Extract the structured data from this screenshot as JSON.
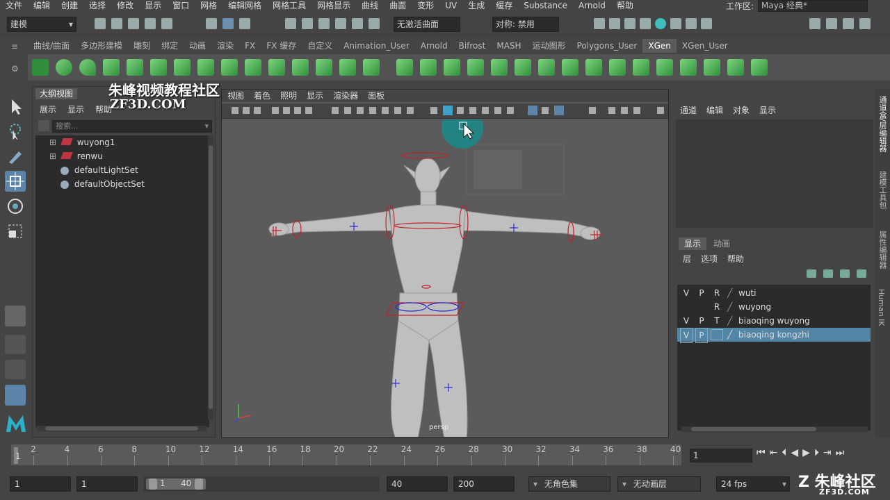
{
  "menubar": {
    "items": [
      "文件",
      "编辑",
      "创建",
      "选择",
      "修改",
      "显示",
      "窗口",
      "网格",
      "编辑网格",
      "网格工具",
      "网格显示",
      "曲线",
      "曲面",
      "变形",
      "UV",
      "生成",
      "缓存",
      "Substance",
      "Arnold",
      "帮助"
    ],
    "workspace_label": "工作区:",
    "workspace_value": "Maya 经典*"
  },
  "statusline": {
    "mode": "建模",
    "live_surface": "无激活曲面",
    "symmetry": "对称: 禁用"
  },
  "shelf": {
    "tabs": [
      "曲线/曲面",
      "多边形建模",
      "雕刻",
      "绑定",
      "动画",
      "渲染",
      "FX",
      "FX 缓存",
      "自定义",
      "Animation_User",
      "Arnold",
      "Bifrost",
      "MASH",
      "运动图形",
      "Polygons_User",
      "XGen",
      "XGen_User"
    ],
    "active": "XGen"
  },
  "outliner": {
    "title": "大纲视图",
    "menu": [
      "展示",
      "显示",
      "帮助"
    ],
    "search_placeholder": "搜索...",
    "items": [
      "wuyong1",
      "renwu",
      "defaultLightSet",
      "defaultObjectSet"
    ]
  },
  "viewport": {
    "menu": [
      "视图",
      "着色",
      "照明",
      "显示",
      "渲染器",
      "面板"
    ],
    "camera_label": "persp"
  },
  "channelbox": {
    "menu": [
      "通道",
      "编辑",
      "对象",
      "显示"
    ]
  },
  "layers": {
    "tabs": [
      "显示",
      "动画"
    ],
    "menu": [
      "层",
      "选项",
      "帮助"
    ],
    "rows": [
      {
        "v": "V",
        "p": "P",
        "r": "R",
        "name": "wuti",
        "selected": false
      },
      {
        "v": "",
        "p": "",
        "r": "R",
        "name": "wuyong",
        "selected": false
      },
      {
        "v": "V",
        "p": "P",
        "r": "T",
        "name": "biaoqing wuyong",
        "selected": false
      },
      {
        "v": "V",
        "p": "P",
        "r": "",
        "name": "biaoqing kongzhi",
        "selected": true
      }
    ]
  },
  "sidebar_tabs": [
    "通道盒/层编辑器",
    "建模工具包",
    "属性编辑器",
    "Human IK"
  ],
  "timeline": {
    "ticks": [
      "2",
      "4",
      "6",
      "8",
      "10",
      "12",
      "14",
      "16",
      "18",
      "20",
      "22",
      "24",
      "26",
      "28",
      "30",
      "32",
      "34",
      "36",
      "38",
      "40"
    ],
    "start_marker": "1",
    "current_frame": "1"
  },
  "range": {
    "start": "1",
    "playback_start": "1",
    "range_start_label": "1",
    "range_end_label": "40",
    "playback_end": "40",
    "end": "200",
    "character_set": "无角色集",
    "anim_layer": "无动画层",
    "fps": "24 fps"
  },
  "watermark": {
    "corner": "Z 朱峰社区",
    "corner_url": "ZF3D.COM",
    "title_cn": "朱峰视频教程社区",
    "title_en": "ZF3D.COM"
  },
  "colors": {
    "accent_selection": "#5285a6",
    "shelf_icon_green": "#4fbf58",
    "curve_red": "#c0202a",
    "locator_blue": "#2a2ad0"
  }
}
